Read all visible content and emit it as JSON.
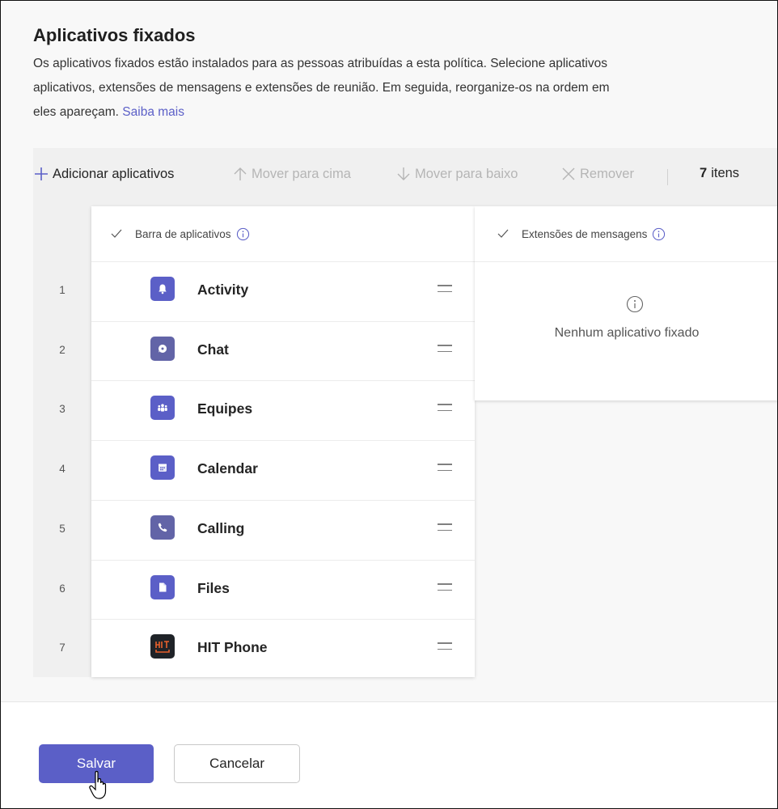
{
  "header": {
    "title": "Aplicativos fixados",
    "description_lines": [
      "Os aplicativos fixados estão instalados para as pessoas atribuídas a esta política. Selecione aplicativos",
      "aplicativos, extensões de mensagens e extensões de reunião. Em seguida, reorganize-os na ordem em",
      "eles apareçam."
    ],
    "learn_more": "Saiba mais"
  },
  "toolbar": {
    "add": "Adicionar aplicativos",
    "move_up": "Mover para cima",
    "move_down": "Mover para baixo",
    "remove": "Remover",
    "count_number": "7",
    "count_label": "itens"
  },
  "app_bar": {
    "header": "Barra de aplicativos",
    "apps": [
      {
        "num": "1",
        "name": "Activity",
        "icon": "bell-icon",
        "color": "#5b5fc7"
      },
      {
        "num": "2",
        "name": "Chat",
        "icon": "chat-icon",
        "color": "#6264a7"
      },
      {
        "num": "3",
        "name": "Equipes",
        "icon": "teams-icon",
        "color": "#5b5fc7"
      },
      {
        "num": "4",
        "name": "Calendar",
        "icon": "calendar-icon",
        "color": "#5b5fc7"
      },
      {
        "num": "5",
        "name": "Calling",
        "icon": "phone-icon",
        "color": "#6264a7"
      },
      {
        "num": "6",
        "name": "Files",
        "icon": "file-icon",
        "color": "#5b5fc7"
      },
      {
        "num": "7",
        "name": "HIT Phone",
        "icon": "hit-phone-logo",
        "color": "#1f2328"
      }
    ]
  },
  "message_extensions": {
    "header": "Extensões de mensagens",
    "empty": "Nenhum aplicativo fixado"
  },
  "footer": {
    "save": "Salvar",
    "cancel": "Cancelar"
  },
  "colors": {
    "accent": "#5b5fc7",
    "disabled": "#b5b5b5"
  }
}
